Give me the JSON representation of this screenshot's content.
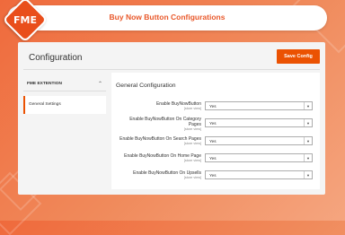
{
  "header": {
    "title": "Buy Now Button Configurations",
    "logo_text": "FME"
  },
  "page": {
    "title": "Configuration",
    "save_label": "Save Config"
  },
  "sidebar": {
    "section_label": "FME EXTENTION",
    "items": [
      {
        "label": "General Settings",
        "active": true
      }
    ]
  },
  "content": {
    "section_title": "General Configuration",
    "rows": [
      {
        "label": "Enable BuyNowButton",
        "scope": "[store view]",
        "value": "Yes"
      },
      {
        "label": "Enable BuyNowButton On Category Pages",
        "scope": "[store view]",
        "value": "Yes"
      },
      {
        "label": "Enable BuyNowButton On Search Pages",
        "scope": "[store view]",
        "value": "Yes"
      },
      {
        "label": "Enable BuyNowButton On Home Page",
        "scope": "[store view]",
        "value": "Yes"
      },
      {
        "label": "Enable BuyNowButton On Upsells",
        "scope": "[store view]",
        "value": "Yes"
      }
    ]
  },
  "colors": {
    "accent": "#eb5202",
    "banner": "#ef6a3c",
    "title": "#e9582a"
  }
}
